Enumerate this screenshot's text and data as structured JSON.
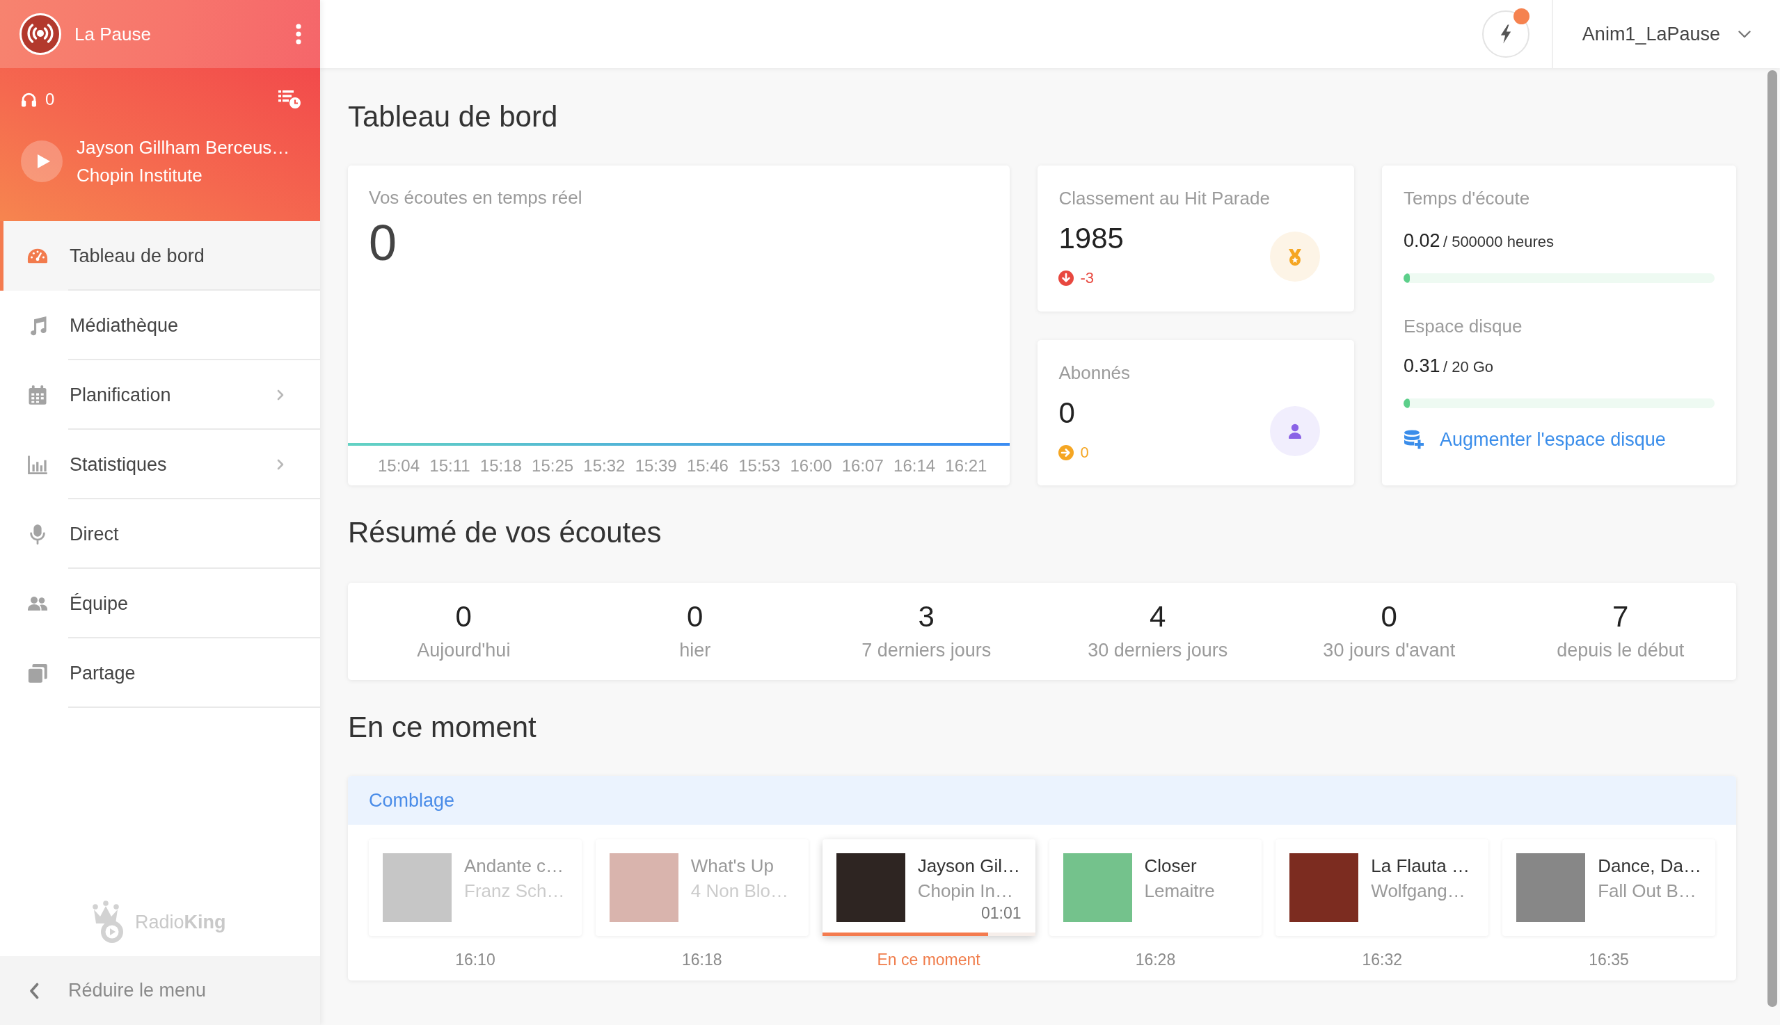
{
  "sidebar": {
    "station": {
      "name": "La Pause"
    },
    "player": {
      "listeners": "0",
      "title": "Jayson Gillham Berceus…",
      "artist": "Chopin Institute"
    },
    "nav": [
      {
        "label": "Tableau de bord",
        "selected": true,
        "has_submenu": false
      },
      {
        "label": "Médiathèque",
        "selected": false,
        "has_submenu": false
      },
      {
        "label": "Planification",
        "selected": false,
        "has_submenu": true
      },
      {
        "label": "Statistiques",
        "selected": false,
        "has_submenu": true
      },
      {
        "label": "Direct",
        "selected": false,
        "has_submenu": false
      },
      {
        "label": "Équipe",
        "selected": false,
        "has_submenu": false
      },
      {
        "label": "Partage",
        "selected": false,
        "has_submenu": false
      }
    ],
    "brand": "Radio**King**",
    "collapse_button": "Réduire le menu"
  },
  "top_bar": {
    "quick_actions": {
      "unread": true
    },
    "user_menu": "Anim1_LaPause"
  },
  "page_title": "Tableau de bord",
  "realtime": {
    "title": "Vos écoutes en temps réel",
    "value": "0",
    "x_axis_labels": [
      "15:04",
      "15:11",
      "15:18",
      "15:25",
      "15:32",
      "15:39",
      "15:46",
      "15:53",
      "16:00",
      "16:07",
      "16:14",
      "16:21"
    ]
  },
  "hit_parade": {
    "title": "Classement au Hit Parade",
    "value": "1985",
    "change": "-3",
    "kind": "down"
  },
  "subscribers": {
    "title": "Abonnés",
    "value": "0",
    "change": "0",
    "kind": "steady"
  },
  "quota": {
    "listening": {
      "title": "Temps d'écoute",
      "value": "0.02",
      "limit": "/ 500000 heures",
      "level": 0.02
    },
    "disk": {
      "title": "Espace disque",
      "value": "0.31",
      "limit": "/ 20 Go",
      "level": 0.02
    },
    "link": "Augmenter l'espace disque"
  },
  "summary": {
    "title": "Résumé de vos écoutes",
    "stats": [
      {
        "value": "0",
        "label": "Aujourd'hui"
      },
      {
        "value": "0",
        "label": "hier"
      },
      {
        "value": "3",
        "label": "7 derniers jours"
      },
      {
        "value": "4",
        "label": "30 derniers jours"
      },
      {
        "value": "0",
        "label": "30 jours d'avant"
      },
      {
        "value": "7",
        "label": "depuis le début"
      }
    ]
  },
  "now_playing": {
    "title": "En ce moment",
    "playlist": "Comblage",
    "tracks": [
      {
        "kind": "played",
        "title": "Andante c…",
        "artist": "Franz Sch…",
        "time": "16:10"
      },
      {
        "kind": "played",
        "title": "What's Up",
        "artist": "4 Non Blo…",
        "time": "16:18"
      },
      {
        "kind": "playing",
        "title": "Jayson Gil…",
        "artist": "Chopin In…",
        "elapsed": "01:01",
        "level": 0.78,
        "time": "En ce moment"
      },
      {
        "kind": "upcoming",
        "title": "Closer",
        "artist": "Lemaitre",
        "time": "16:28"
      },
      {
        "kind": "upcoming",
        "title": "La Flauta …",
        "artist": "Wolfgang…",
        "time": "16:32"
      },
      {
        "kind": "upcoming",
        "title": "Dance, Da…",
        "artist": "Fall Out B…",
        "time": "16:35"
      }
    ]
  }
}
